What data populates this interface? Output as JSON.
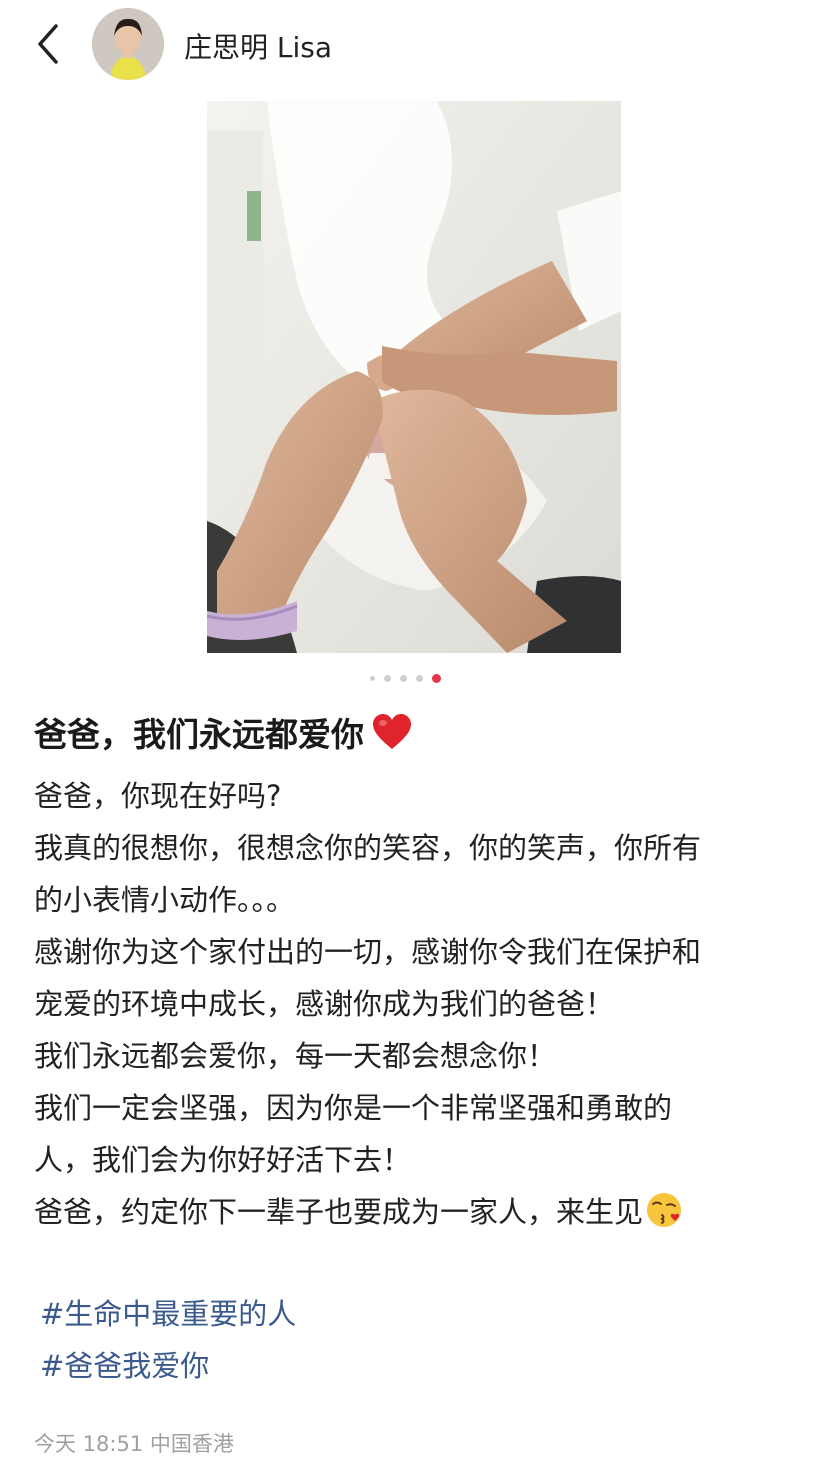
{
  "header": {
    "username": "庄思明 Lisa",
    "back_icon": "chevron-left-icon"
  },
  "carousel": {
    "total": 5,
    "active_index": 4
  },
  "post": {
    "title": "爸爸，我们永远都爱你",
    "title_emoji": "red-heart-icon",
    "lines": [
      "爸爸，你现在好吗?",
      "我真的很想你，很想念你的笑容，你的笑声，你所有",
      "的小表情小动作。。。",
      "感谢你为这个家付出的一切，感谢你令我们在保护和",
      "宠爱的环境中成长，感谢你成为我们的爸爸！",
      "我们永远都会爱你，每一天都会想念你！",
      "我们一定会坚强，因为你是一个非常坚强和勇敢的",
      "人，我们会为你好好活下去！",
      "爸爸，约定你下一辈子也要成为一家人，来生见"
    ],
    "last_line_emoji": "kissing-face-icon",
    "hashtags": [
      "#生命中最重要的人",
      "#爸爸我爱你"
    ],
    "timestamp": "今天 18:51 中国香港"
  },
  "colors": {
    "hashtag": "#3b5a8e",
    "active_dot": "#e5394a",
    "meta_text": "#a0a0a0"
  }
}
